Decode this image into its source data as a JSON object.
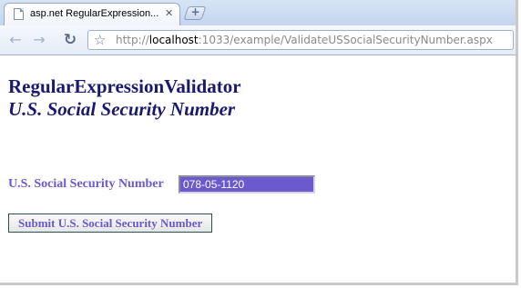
{
  "browser": {
    "tab_title": "asp.net RegularExpression...",
    "tab_close": "✕",
    "new_tab": "+",
    "url_prefix": "http://",
    "url_host": "localhost",
    "url_rest": ":1033/example/ValidateUSSocialSecurityNumber.aspx",
    "icons": {
      "back": "back-arrow-icon",
      "forward": "forward-arrow-icon",
      "reload": "reload-icon",
      "bookmark": "star-icon"
    }
  },
  "page": {
    "title": "RegularExpressionValidator",
    "subtitle": "U.S. Social Security Number",
    "field_label": "U.S. Social Security Number",
    "ssn_value": "078-05-1120",
    "submit_label": "Submit U.S. Social Security Number"
  },
  "colors": {
    "heading": "#191970",
    "accent": "#6a5acd",
    "input_bg": "#6a5acd",
    "input_text": "#ffffff"
  }
}
